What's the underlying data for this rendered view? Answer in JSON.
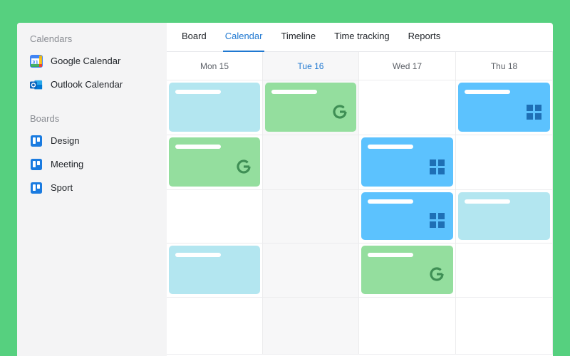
{
  "colors": {
    "background": "#56d07f",
    "accent": "#1f78d1",
    "event_light": "#b3e6f0",
    "event_green": "#94de9e",
    "event_blue": "#5cc2fe"
  },
  "sidebar": {
    "calendars_title": "Calendars",
    "calendars": [
      {
        "label": "Google Calendar",
        "icon": "google-calendar-icon"
      },
      {
        "label": "Outlook Calendar",
        "icon": "outlook-icon"
      }
    ],
    "boards_title": "Boards",
    "boards": [
      {
        "label": "Design",
        "icon": "trello-icon"
      },
      {
        "label": "Meeting",
        "icon": "trello-icon"
      },
      {
        "label": "Sport",
        "icon": "trello-icon"
      }
    ]
  },
  "tabs": [
    {
      "label": "Board",
      "active": false
    },
    {
      "label": "Calendar",
      "active": true
    },
    {
      "label": "Timeline",
      "active": false
    },
    {
      "label": "Time tracking",
      "active": false
    },
    {
      "label": "Reports",
      "active": false
    }
  ],
  "calendar": {
    "days": [
      {
        "label": "Mon 15",
        "today": false
      },
      {
        "label": "Tue 16",
        "today": true
      },
      {
        "label": "Wed 17",
        "today": false
      },
      {
        "label": "Thu 18",
        "today": false
      }
    ],
    "rows": [
      [
        {
          "type": "light"
        },
        {
          "type": "green",
          "icon": "google-g-icon"
        },
        null,
        {
          "type": "blue",
          "icon": "windows-grid-icon"
        }
      ],
      [
        {
          "type": "green",
          "icon": "google-g-icon"
        },
        null,
        {
          "type": "blue",
          "icon": "windows-grid-icon"
        },
        null
      ],
      [
        null,
        null,
        {
          "type": "blue",
          "icon": "windows-grid-icon"
        },
        {
          "type": "light"
        }
      ],
      [
        {
          "type": "light"
        },
        null,
        {
          "type": "green",
          "icon": "google-g-icon"
        },
        null
      ],
      [
        null,
        null,
        null,
        null
      ]
    ]
  }
}
